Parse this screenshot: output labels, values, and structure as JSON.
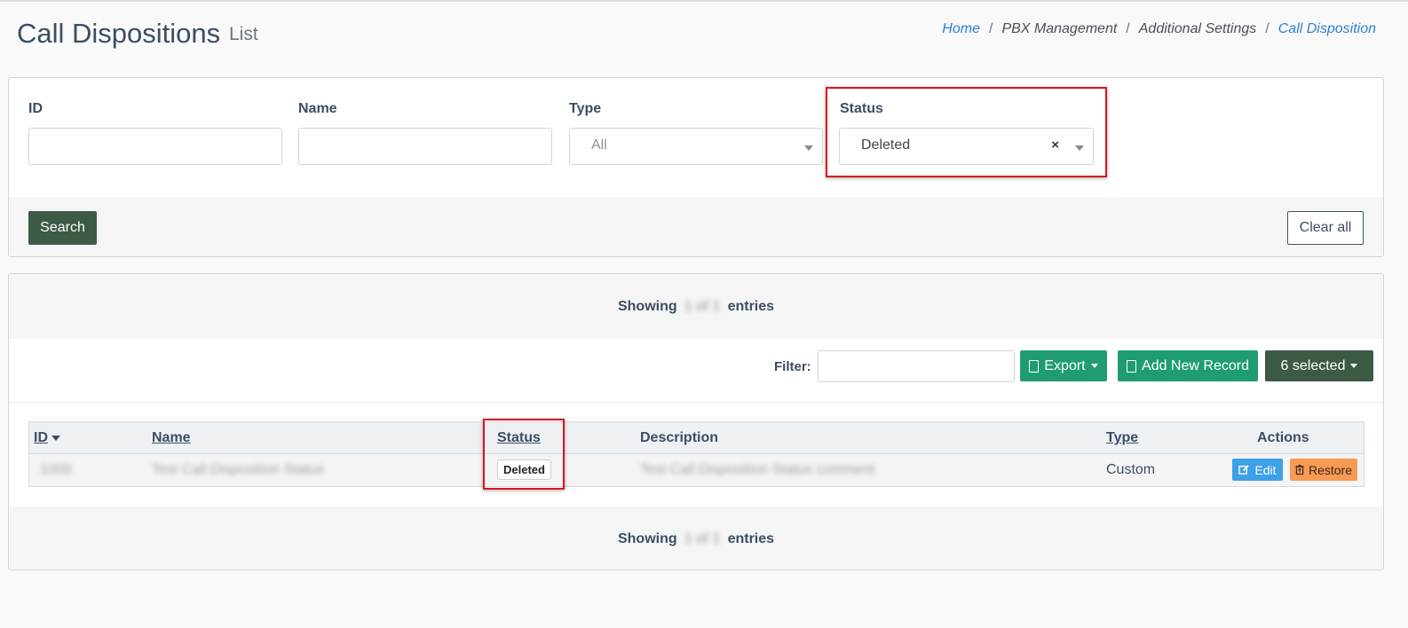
{
  "header": {
    "title": "Call Dispositions",
    "subtitle": "List",
    "breadcrumb": [
      "Home",
      "PBX Management",
      "Additional Settings",
      "Call Disposition"
    ]
  },
  "search": {
    "fields": {
      "id_label": "ID",
      "name_label": "Name",
      "type_label": "Type",
      "type_placeholder": "All",
      "status_label": "Status",
      "status_value": "Deleted",
      "status_clear": "×"
    },
    "search_button": "Search",
    "clear_button": "Clear all"
  },
  "list": {
    "showing_prefix": "Showing",
    "showing_count": "1 of 1",
    "showing_suffix": "entries",
    "filter_label": "Filter:",
    "export_label": "Export",
    "add_label": "Add New Record",
    "selected_label": "6 selected",
    "columns": {
      "id": "ID",
      "name": "Name",
      "status": "Status",
      "description": "Description",
      "type": "Type",
      "actions": "Actions"
    },
    "rows": [
      {
        "id": "1000",
        "name": "Test Call Disposition Status",
        "status": "Deleted",
        "description": "Test Call Disposition Status comment",
        "type": "Custom",
        "edit_label": "Edit",
        "restore_label": "Restore"
      }
    ]
  },
  "colors": {
    "primary_dark": "#3d5a45",
    "success": "#1f9d70",
    "info": "#3ea0e6",
    "warning": "#f79a55",
    "link": "#2f7fd4",
    "highlight": "#d9161c"
  }
}
